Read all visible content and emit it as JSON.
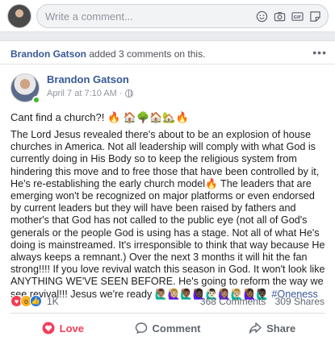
{
  "composer": {
    "placeholder": "Write a comment...",
    "tools": [
      "emoji-icon",
      "camera-icon",
      "gif-icon",
      "sticker-icon"
    ]
  },
  "activity": {
    "user": "Brandon Gatson",
    "text": " added 3 comments on this."
  },
  "post": {
    "author": "Brandon Gatson",
    "timestamp": "April 7 at 7:10 AM",
    "separator": "·",
    "title": "Cant find a church?! 🔥 🏠🌳🏠🏡🔥",
    "body": "The Lord Jesus revealed there's about to be an explosion of house churches in America. Not all leadership will comply with what God is currently doing in His Body so to keep the religious system from hindering this move and to free those that have been controlled by it, He's re-establishing the early church model🔥 The leaders that are emerging won't be recognized on major platforms or even endorsed by current leaders but they will have been raised by fathers and mother's that God has not called to the public eye (not all of God's generals or the people God is using has a stage. Not all of what He's doing is mainstreamed. It's irresponsible to think that way because He always keeps a remnant.) Over the next 3 months it will hit the fan strong!!!! If you love revival watch this season in God. It won't look like ANYTHING WE'VE SEEN BEFORE. He's going to reform the way we see revival!!! Jesus we're ready 🙋🏽‍♂️🙋🏼‍♀️🙋🏾‍♂️🙋🏿‍♀️🙋🏻‍♂️🙋🏽‍♀️🙋🏼‍♂️🙋🏾‍♀️🙋🏿‍♂️ ",
    "hashtag": "#Oneness"
  },
  "stats": {
    "reaction_count": "1K",
    "comments": "368 Comments",
    "shares": "309 Shares"
  },
  "actions": {
    "love": "Love",
    "comment": "Comment",
    "share": "Share"
  },
  "colors": {
    "link": "#385898",
    "love": "#f33e58",
    "wow": "#f7b125",
    "like": "#1877f2",
    "online": "#42b72a"
  }
}
